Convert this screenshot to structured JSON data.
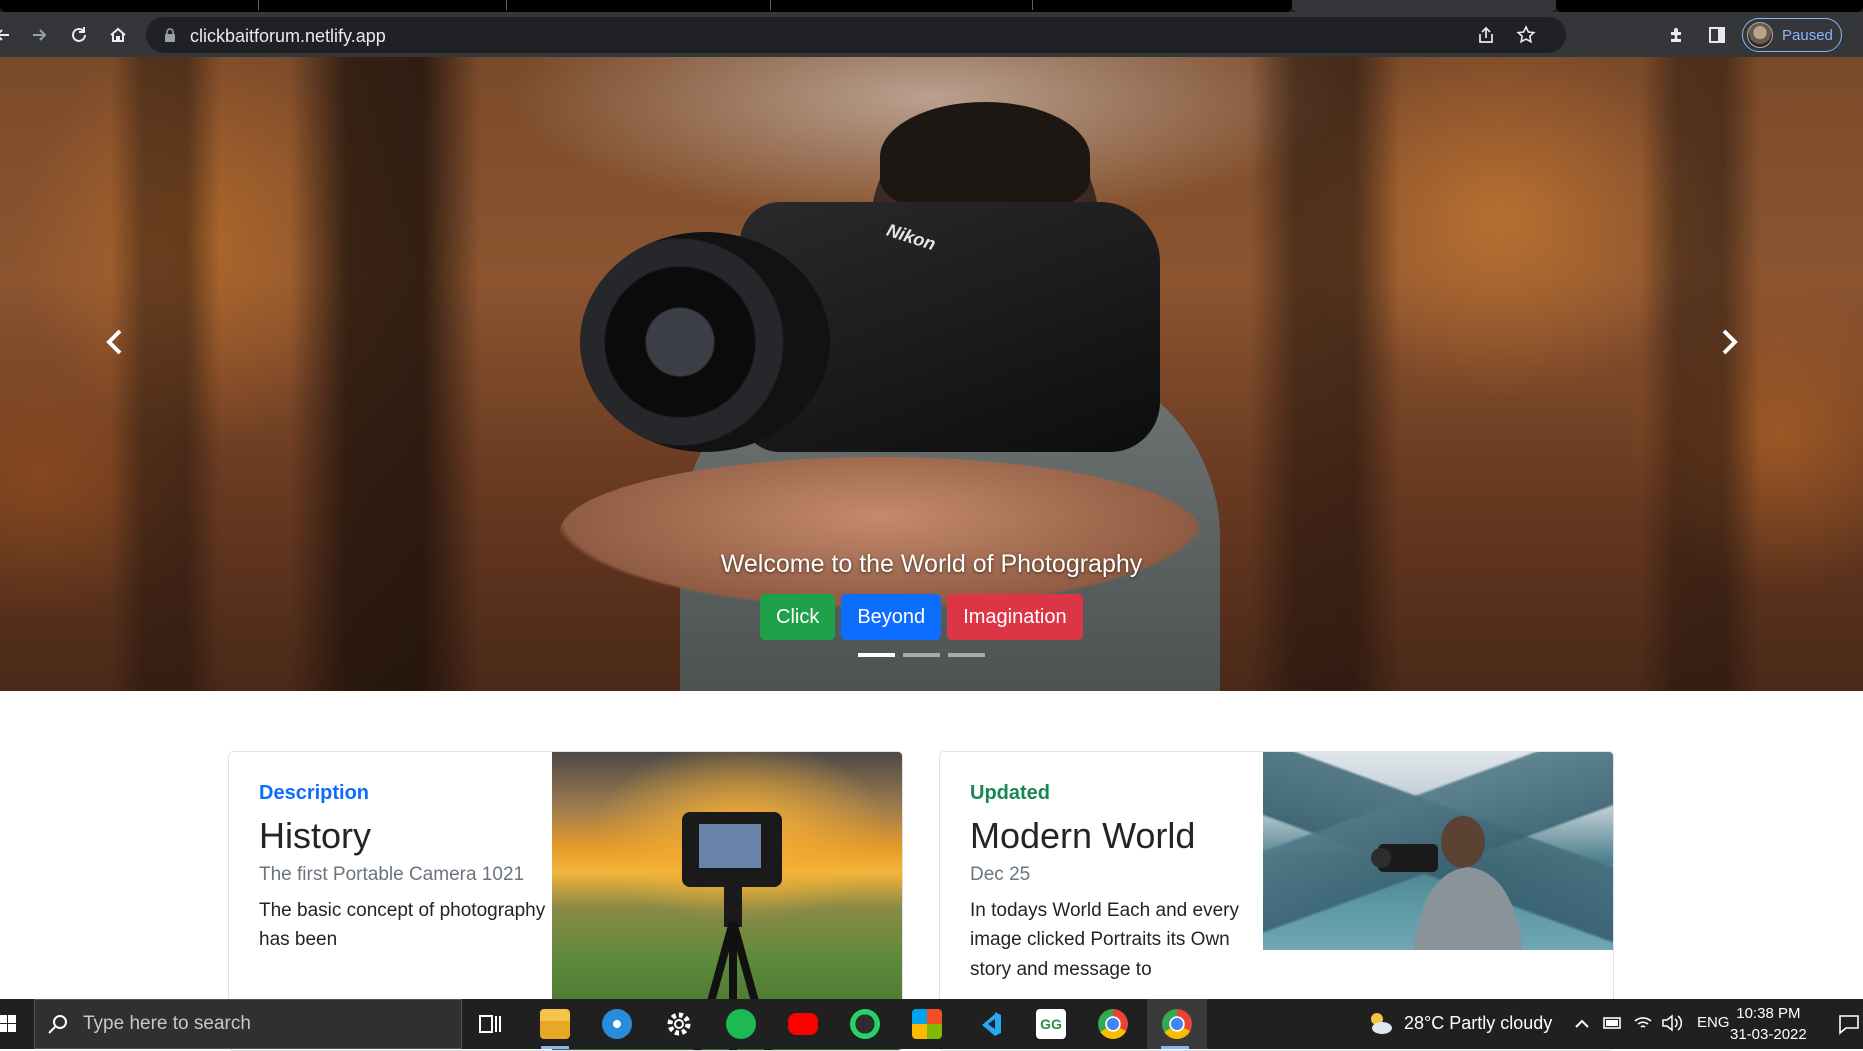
{
  "browser": {
    "url": "clickbaitforum.netlify.app",
    "profile_label": "Paused"
  },
  "carousel": {
    "caption": "Welcome to the World of Photography",
    "buttons": [
      "Click",
      "Beyond",
      "Imagination"
    ],
    "camera_brand": "Nikon",
    "active_slide": 1,
    "slide_count": 3
  },
  "cards": [
    {
      "eyebrow": "Description",
      "eyebrow_color": "#0d6efd",
      "title": "History",
      "muted": "The first Portable Camera 1021",
      "text": "The basic concept of photography has been"
    },
    {
      "eyebrow": "Updated",
      "eyebrow_color": "#198754",
      "title": "Modern World",
      "muted": "Dec 25",
      "text": "In todays World Each and every image clicked Portraits its Own story and message to"
    }
  ],
  "taskbar": {
    "search_placeholder": "Type here to search",
    "weather": "28°C  Partly cloudy",
    "language": "ENG",
    "time": "10:38 PM",
    "date": "31-03-2022",
    "apps": [
      "task-view",
      "file-explorer",
      "browser-compass",
      "settings",
      "spotify",
      "youtube",
      "whatsapp",
      "office",
      "vs-code",
      "geeksforgeeks",
      "chrome",
      "chrome-active"
    ]
  }
}
